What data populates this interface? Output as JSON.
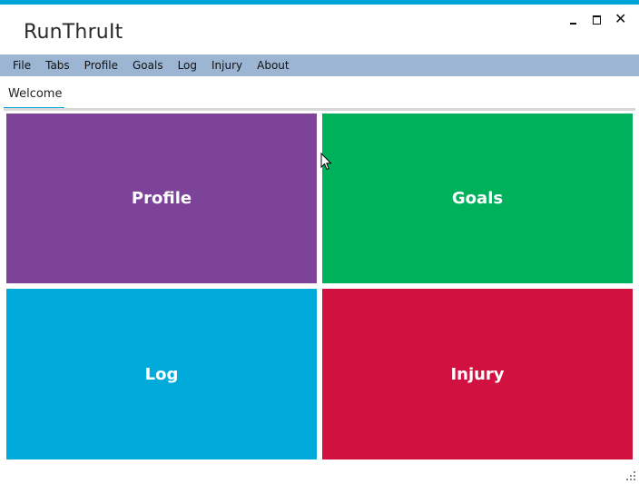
{
  "window": {
    "title": "RunThruIt",
    "accent_color": "#00a5d7",
    "controls": [
      "minimize-icon",
      "maximize-icon",
      "close-icon"
    ],
    "close_glyph": "✕"
  },
  "menu": {
    "items": [
      {
        "label": "File"
      },
      {
        "label": "Tabs"
      },
      {
        "label": "Profile"
      },
      {
        "label": "Goals"
      },
      {
        "label": "Log"
      },
      {
        "label": "Injury"
      },
      {
        "label": "About"
      }
    ],
    "background": "#9cb5d3"
  },
  "tabs": {
    "active": {
      "label": "Welcome"
    }
  },
  "tiles": [
    {
      "label": "Profile",
      "color": "#7d4399"
    },
    {
      "label": "Goals",
      "color": "#00b15b"
    },
    {
      "label": "Log",
      "color": "#00abdc"
    },
    {
      "label": "Injury",
      "color": "#d11241"
    }
  ]
}
